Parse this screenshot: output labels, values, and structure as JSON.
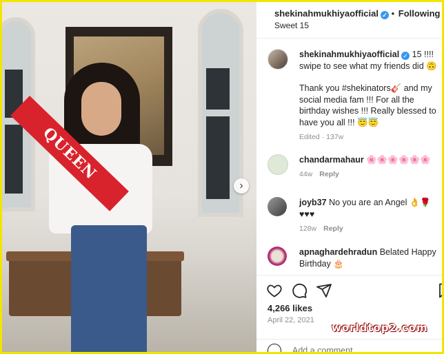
{
  "post": {
    "username": "shekinahmukhiyaofficial",
    "follow_state": "Following",
    "location_text": "Sweet 15",
    "sash_text": "QUEEN"
  },
  "caption": {
    "username": "shekinahmukhiyaofficial",
    "text_1": "15 !!!! swipe to see what my friends did 🙃",
    "text_2": "Thank you #shekinators🎸 and my social media fam !!! For all the birthday wishes !!! Really blessed to have you all !!! 😇😇",
    "meta": "Edited · 137w"
  },
  "comments": [
    {
      "username": "chandarmahaur",
      "text": "🌸🌸🌸🌸🌸🌸",
      "time": "44w",
      "reply": "Reply"
    },
    {
      "username": "joyb37",
      "text": "No you are an Angel 👌🌹♥♥♥",
      "time": "128w",
      "reply": "Reply"
    },
    {
      "username": "apnaghardehradun",
      "text": "Belated Happy Birthday 🎂"
    }
  ],
  "stats": {
    "likes": "4,266 likes",
    "date": "April 22, 2021"
  },
  "add_comment": {
    "placeholder": "Add a comment..."
  },
  "watermark": "worldtop2.com",
  "colors": {
    "verified": "#3897f0",
    "border": "#f2e600",
    "sash": "#d9232c"
  },
  "icons": [
    "next-arrow-icon",
    "verified-badge-icon",
    "heart-icon",
    "comment-icon",
    "share-icon",
    "save-icon",
    "emoji-icon"
  ]
}
